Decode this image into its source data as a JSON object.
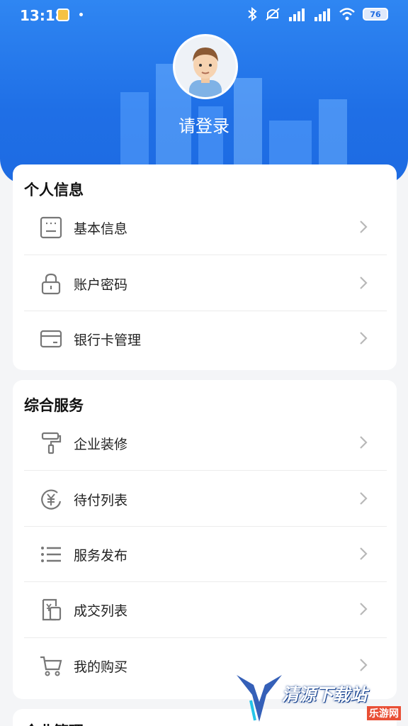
{
  "status_bar": {
    "time": "13:18",
    "battery": "76"
  },
  "profile": {
    "login_label": "请登录"
  },
  "personal_info": {
    "title": "个人信息",
    "items": [
      {
        "label": "基本信息",
        "icon": "id-card-icon"
      },
      {
        "label": "账户密码",
        "icon": "lock-icon"
      },
      {
        "label": "银行卡管理",
        "icon": "bank-card-icon"
      }
    ]
  },
  "services": {
    "title": "综合服务",
    "items": [
      {
        "label": "企业装修",
        "icon": "paint-roller-icon"
      },
      {
        "label": "待付列表",
        "icon": "yen-circle-icon"
      },
      {
        "label": "服务发布",
        "icon": "list-icon"
      },
      {
        "label": "成交列表",
        "icon": "receipt-icon"
      },
      {
        "label": "我的购买",
        "icon": "cart-icon"
      }
    ]
  },
  "next_section": {
    "title": "企业管理"
  },
  "watermark": {
    "text": "清源下载站",
    "sub": "乐游网"
  },
  "colors": {
    "header_blue": "#1f6fe6",
    "icon_gray": "#777777",
    "chevron": "#b8b8b8"
  }
}
